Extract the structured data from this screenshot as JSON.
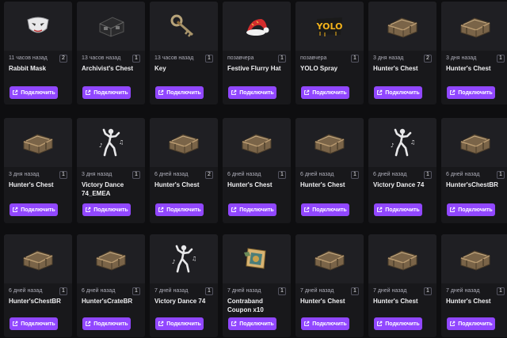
{
  "connect_label": "Подключить",
  "rows": [
    [
      {
        "time": "11 часов назад",
        "count": "2",
        "name": "Rabbit Mask",
        "icon": "mask"
      },
      {
        "time": "13 часов назад",
        "count": "1",
        "name": "Archivist's Chest",
        "icon": "dark-chest"
      },
      {
        "time": "13 часов назад",
        "count": "1",
        "name": "Key",
        "icon": "key"
      },
      {
        "time": "позавчера",
        "count": "1",
        "name": "Festive Flurry Hat",
        "icon": "hat"
      },
      {
        "time": "позавчера",
        "count": "1",
        "name": "YOLO Spray",
        "icon": "spray"
      },
      {
        "time": "3 дня назад",
        "count": "2",
        "name": "Hunter's Chest",
        "icon": "chest"
      },
      {
        "time": "3 дня назад",
        "count": "1",
        "name": "Hunter's Chest",
        "icon": "chest"
      }
    ],
    [
      {
        "time": "3 дня назад",
        "count": "1",
        "name": "Hunter's Chest",
        "icon": "chest"
      },
      {
        "time": "3 дня назад",
        "count": "1",
        "name": "Victory Dance 74_EMEA",
        "icon": "dance"
      },
      {
        "time": "6 дней назад",
        "count": "2",
        "name": "Hunter's Chest",
        "icon": "chest"
      },
      {
        "time": "6 дней назад",
        "count": "1",
        "name": "Hunter's Chest",
        "icon": "chest"
      },
      {
        "time": "6 дней назад",
        "count": "1",
        "name": "Hunter's Chest",
        "icon": "chest"
      },
      {
        "time": "6 дней назад",
        "count": "1",
        "name": "Victory Dance 74",
        "icon": "dance"
      },
      {
        "time": "6 дней назад",
        "count": "1",
        "name": "Hunter'sChestBR",
        "icon": "chest"
      }
    ],
    [
      {
        "time": "6 дней назад",
        "count": "1",
        "name": "Hunter'sChestBR",
        "icon": "chest"
      },
      {
        "time": "6 дней назад",
        "count": "1",
        "name": "Hunter'sCrateBR",
        "icon": "chest"
      },
      {
        "time": "7 дней назад",
        "count": "1",
        "name": "Victory Dance 74",
        "icon": "dance"
      },
      {
        "time": "7 дней назад",
        "count": "1",
        "name": "Contraband Coupon x10",
        "icon": "coupon"
      },
      {
        "time": "7 дней назад",
        "count": "1",
        "name": "Hunter's Chest",
        "icon": "chest"
      },
      {
        "time": "7 дней назад",
        "count": "1",
        "name": "Hunter's Chest",
        "icon": "chest"
      },
      {
        "time": "7 дней назад",
        "count": "1",
        "name": "Hunter's Chest",
        "icon": "chest"
      }
    ]
  ]
}
